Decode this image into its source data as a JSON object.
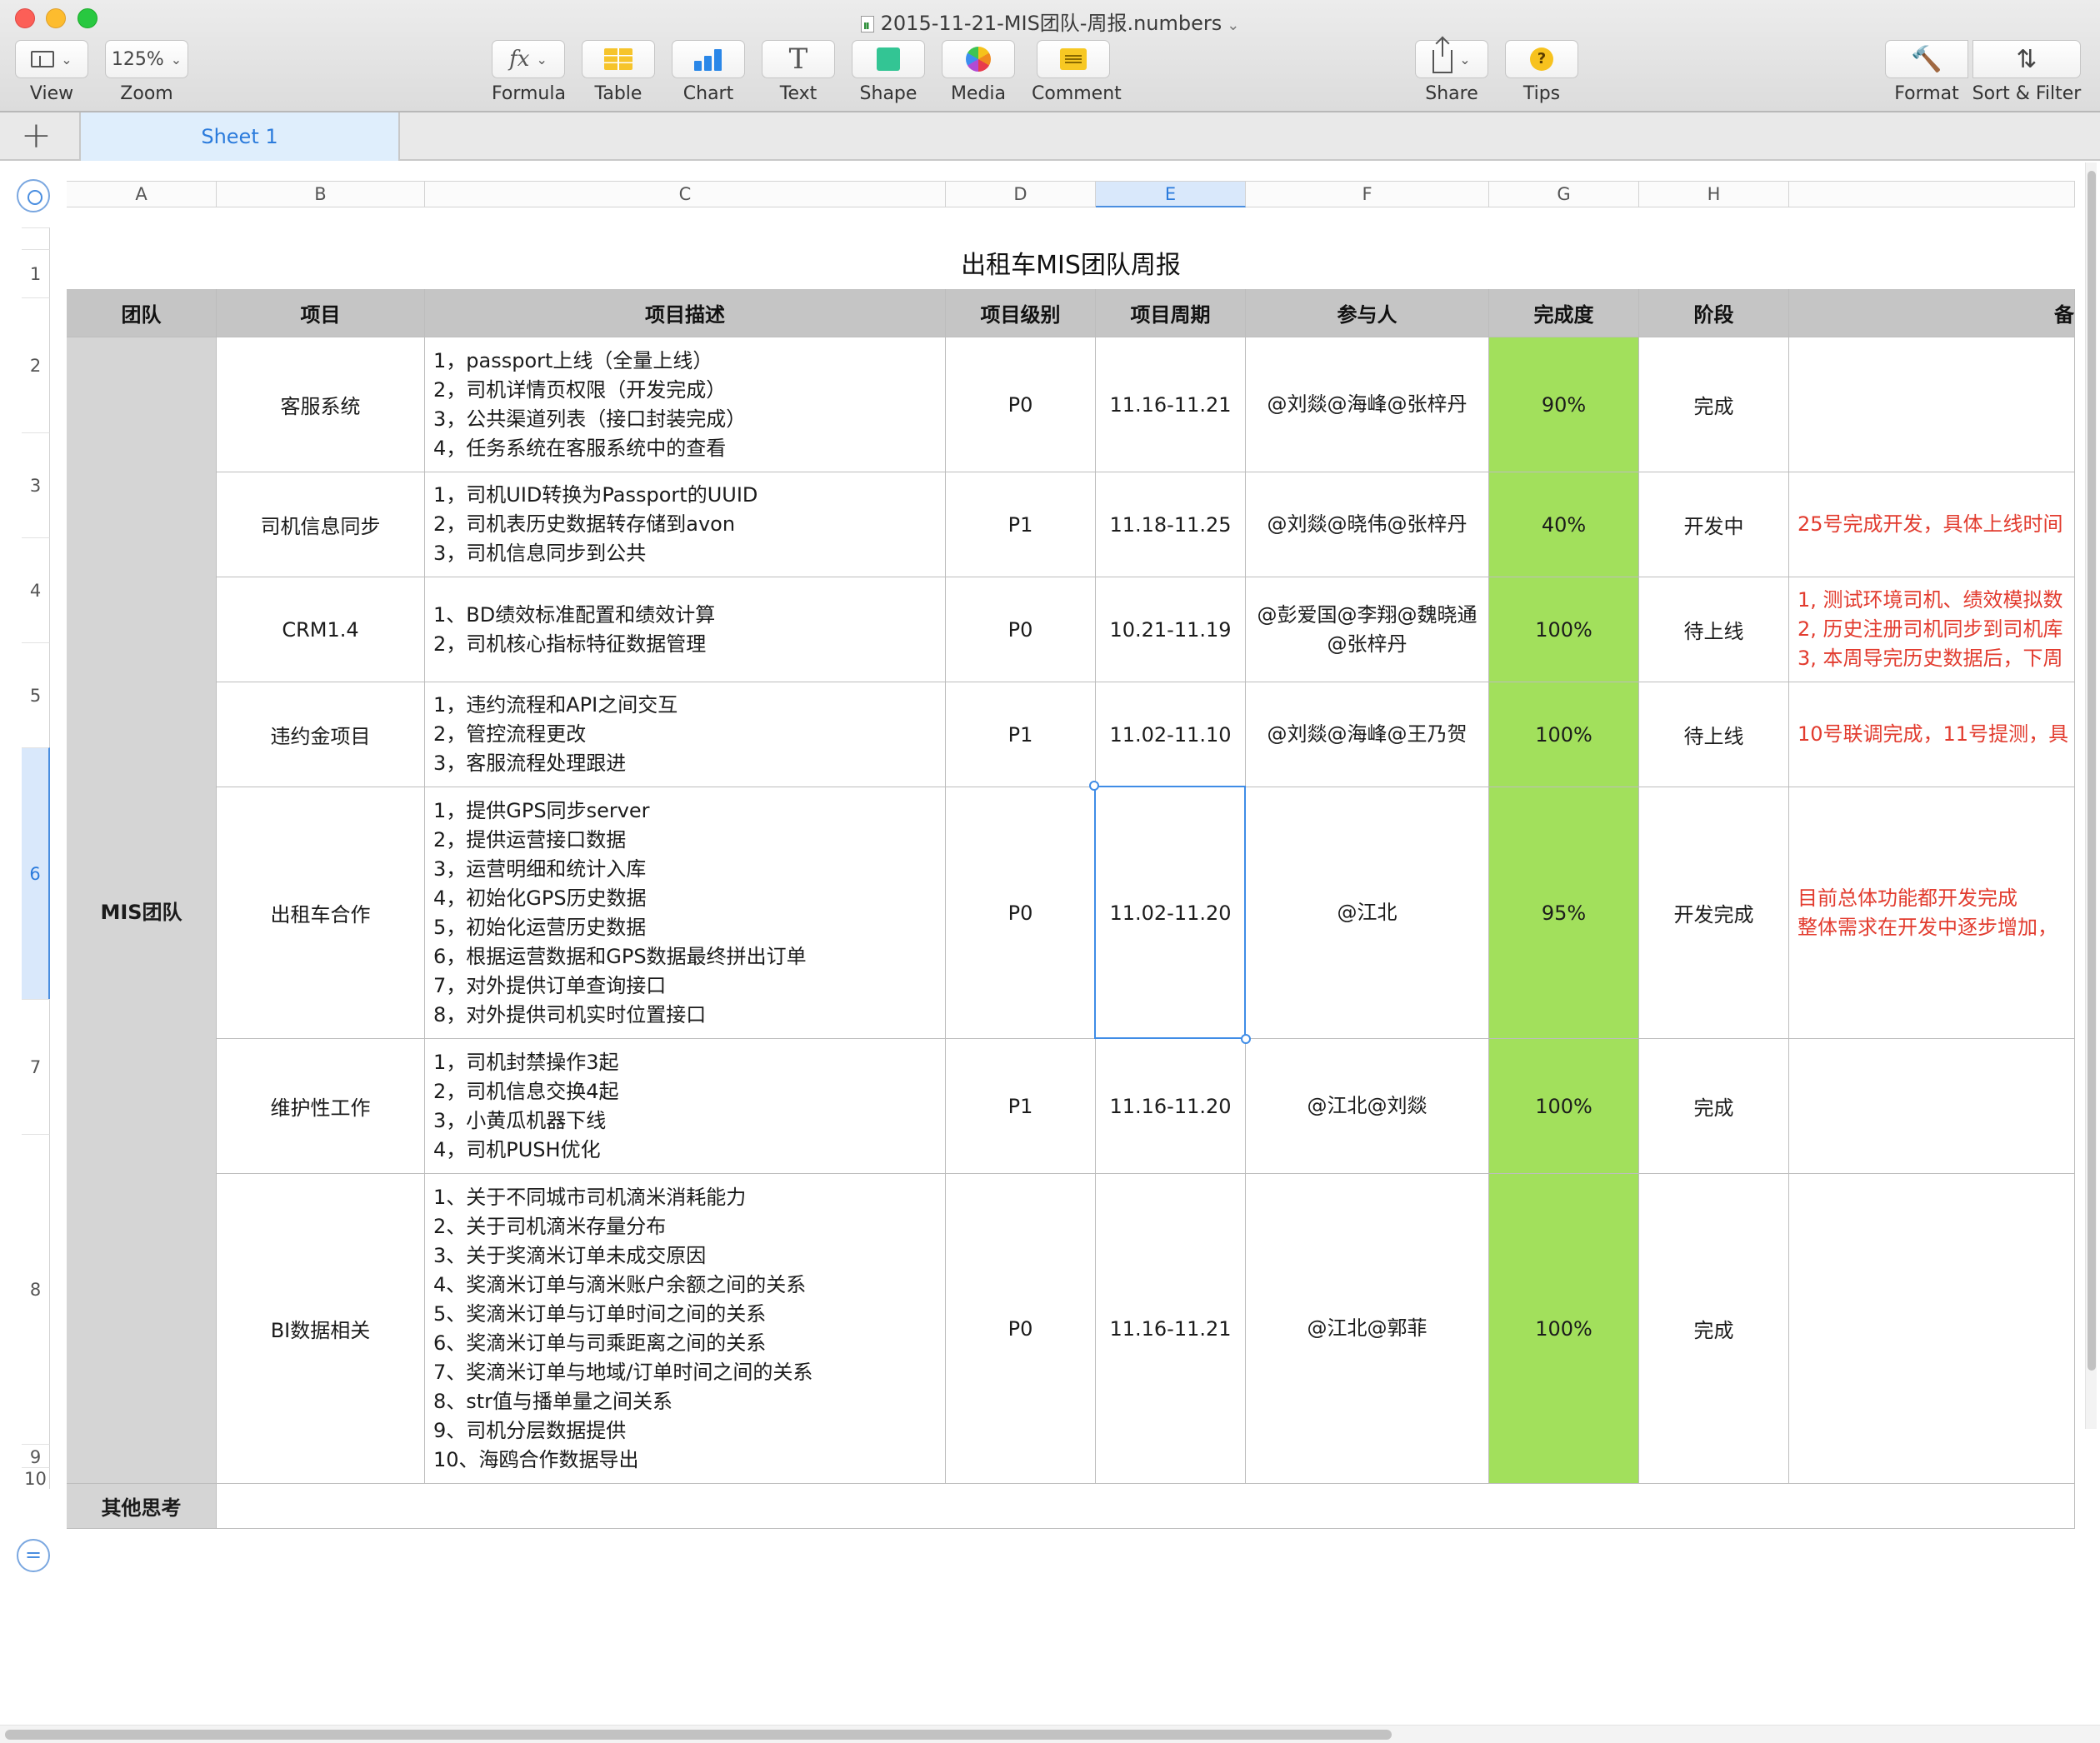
{
  "window": {
    "title": "2015-11-21-MIS团队-周报.numbers",
    "title_chevron": "⌄"
  },
  "toolbar": {
    "view_label": "View",
    "zoom_value": "125%",
    "zoom_label": "Zoom",
    "formula_glyph": "fx",
    "formula_label": "Formula",
    "table_label": "Table",
    "chart_label": "Chart",
    "text_glyph": "T",
    "text_label": "Text",
    "shape_label": "Shape",
    "media_label": "Media",
    "comment_label": "Comment",
    "share_label": "Share",
    "tips_glyph": "?",
    "tips_label": "Tips",
    "format_glyph": "🔨",
    "format_label": "Format",
    "sort_glyph": "⇅",
    "sort_label": "Sort & Filter"
  },
  "tabs": {
    "add_glyph": "+",
    "sheet1": "Sheet 1"
  },
  "columns": [
    "A",
    "B",
    "C",
    "D",
    "E",
    "F",
    "G",
    "H",
    ""
  ],
  "rows": [
    "1",
    "2",
    "3",
    "4",
    "5",
    "6",
    "7",
    "8",
    "9",
    "10"
  ],
  "report": {
    "title": "出租车MIS团队周报",
    "headers": [
      "团队",
      "项目",
      "项目描述",
      "项目级别",
      "项目周期",
      "参与人",
      "完成度",
      "阶段",
      "备"
    ],
    "team": "MIS团队",
    "other_label": "其他思考",
    "items": [
      {
        "project": "客服系统",
        "desc": [
          "1，passport上线（全量上线）",
          "2，司机详情页权限（开发完成）",
          "3，公共渠道列表（接口封装完成）",
          "4，任务系统在客服系统中的查看"
        ],
        "level": "P0",
        "period": "11.16-11.21",
        "people": "@刘燚@海峰@张梓丹",
        "pct": "90%",
        "stage": "完成",
        "notes": []
      },
      {
        "project": "司机信息同步",
        "desc": [
          "1，司机UID转换为Passport的UUID",
          "2，司机表历史数据转存储到avon",
          "3，司机信息同步到公共"
        ],
        "level": "P1",
        "period": "11.18-11.25",
        "people": "@刘燚@晓伟@张梓丹",
        "pct": "40%",
        "stage": "开发中",
        "notes": [
          "25号完成开发，具体上线时间"
        ]
      },
      {
        "project": "CRM1.4",
        "desc": [
          "1、BD绩效标准配置和绩效计算",
          "2，司机核心指标特征数据管理"
        ],
        "level": "P0",
        "period": "10.21-11.19",
        "people": "@彭爱国@李翔@魏晓通@张梓丹",
        "pct": "100%",
        "stage": "待上线",
        "notes": [
          "1, 测试环境司机、绩效模拟数",
          "2, 历史注册司机同步到司机库",
          "3, 本周导完历史数据后，下周"
        ]
      },
      {
        "project": "违约金项目",
        "desc": [
          "1，违约流程和API之间交互",
          "2，管控流程更改",
          "3，客服流程处理跟进"
        ],
        "level": "P1",
        "period": "11.02-11.10",
        "people": "@刘燚@海峰@王乃贺",
        "pct": "100%",
        "stage": "待上线",
        "notes": [
          "10号联调完成，11号提测，具"
        ]
      },
      {
        "project": "出租车合作",
        "desc": [
          "1，提供GPS同步server",
          "2，提供运营接口数据",
          "3，运营明细和统计入库",
          "4，初始化GPS历史数据",
          "5，初始化运营历史数据",
          "6，根据运营数据和GPS数据最终拼出订单",
          "7，对外提供订单查询接口",
          "8，对外提供司机实时位置接口"
        ],
        "level": "P0",
        "period": "11.02-11.20",
        "people": "@江北",
        "pct": "95%",
        "stage": "开发完成",
        "notes": [
          "目前总体功能都开发完成",
          "整体需求在开发中逐步增加，"
        ]
      },
      {
        "project": "维护性工作",
        "desc": [
          "1，司机封禁操作3起",
          "2，司机信息交换4起",
          "3，小黄瓜机器下线",
          "4，司机PUSH优化"
        ],
        "level": "P1",
        "period": "11.16-11.20",
        "people": "@江北@刘燚",
        "pct": "100%",
        "stage": "完成",
        "notes": []
      },
      {
        "project": "BI数据相关",
        "desc": [
          "1、关于不同城市司机滴米消耗能力",
          "2、关于司机滴米存量分布",
          "3、关于奖滴米订单未成交原因",
          "4、奖滴米订单与滴米账户余额之间的关系",
          "5、奖滴米订单与订单时间之间的关系",
          "6、奖滴米订单与司乘距离之间的关系",
          "7、奖滴米订单与地域/订单时间之间的关系",
          "8、str值与播单量之间关系",
          "9、司机分层数据提供",
          "10、海鸥合作数据导出"
        ],
        "level": "P0",
        "period": "11.16-11.21",
        "people": "@江北@郭菲",
        "pct": "100%",
        "stage": "完成",
        "notes": []
      }
    ]
  },
  "colors": {
    "progress_fill": "#a2e05c",
    "header_fill": "#c5c5c5",
    "team_fill": "#d5d5d5",
    "note_text": "#e23b2e",
    "selection": "#3f8ce6"
  }
}
